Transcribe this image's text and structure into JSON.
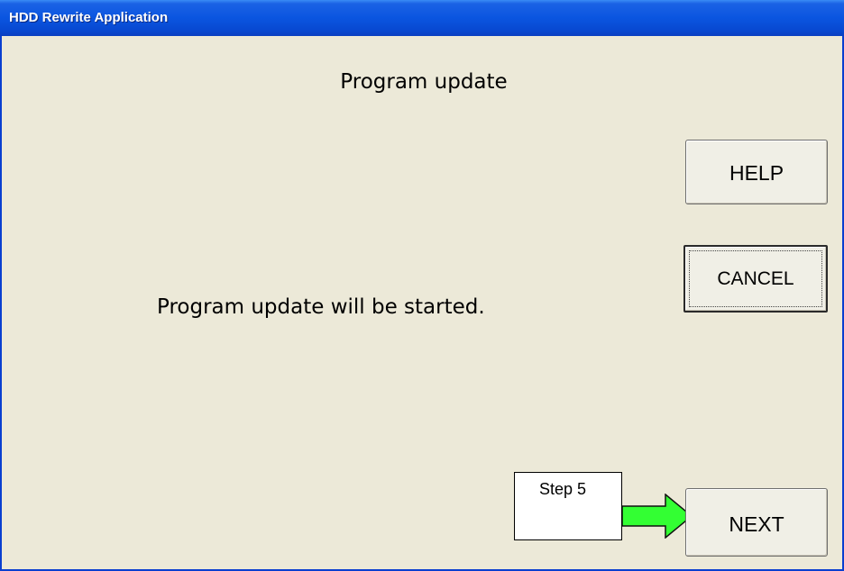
{
  "window": {
    "title": "HDD Rewrite Application"
  },
  "main": {
    "heading": "Program update",
    "message": "Program update will be started."
  },
  "buttons": {
    "help": "HELP",
    "cancel": "CANCEL",
    "next": "NEXT"
  },
  "annotation": {
    "step_label": "Step 5",
    "arrow_color": "#33ff33"
  },
  "colors": {
    "titlebar": "#0a55e0",
    "window_background": "#ece9d8",
    "button_face": "#f0efe6"
  }
}
